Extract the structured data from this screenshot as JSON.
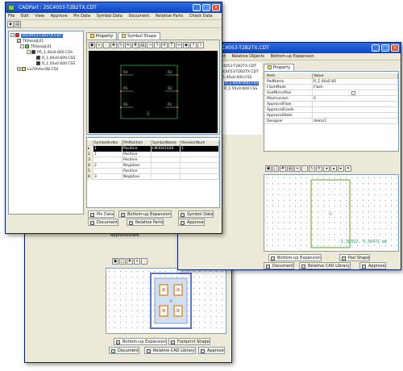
{
  "window1": {
    "title": "CADPart : 2SC4053-T2B2TX.CDT",
    "menu": [
      "File",
      "Edit",
      "View",
      "Approve",
      "Pin Data",
      "Symbol Data",
      "Document",
      "Relative Parts",
      "Check Data"
    ],
    "tree": [
      {
        "label": "2SC4053-T2B2TX.CDT",
        "level": 0,
        "selected": true
      },
      {
        "label": "TRAesaJL01",
        "level": 1
      },
      {
        "label": "TRAesaJL01",
        "level": 2
      },
      {
        "label": "PR_1.40x0.600.CSS",
        "level": 3
      },
      {
        "label": "R_1.40x0.600.CSS",
        "level": 4
      },
      {
        "label": "R_1.50x0.600.CSS",
        "level": 4
      },
      {
        "label": "La70hAsn0B.C56",
        "level": 1
      }
    ],
    "tabs": {
      "property": "Property",
      "symbol_shape": "Symbol Shape"
    },
    "schematic": {
      "pin_labels": [
        "R4",
        "R5",
        "R6",
        "R3",
        "R2",
        "R1"
      ],
      "ref_label": "S"
    },
    "grid": {
      "headers": [
        "SymbolIndex",
        "PinPosition",
        "SymbolName",
        "RevisionNum"
      ],
      "rows": [
        [
          "1",
          "1",
          "Positive",
          "LM3041026",
          "1"
        ],
        [
          "2",
          "1",
          "Positive",
          "",
          ""
        ],
        [
          "3",
          "",
          "Positive",
          "",
          ""
        ],
        [
          "4",
          "2",
          "Negative",
          "",
          ""
        ],
        [
          "5",
          "",
          "Positive",
          "",
          ""
        ],
        [
          "6",
          "3",
          "Negative",
          "",
          ""
        ]
      ]
    },
    "bottom_tabs_row1": [
      "Pin Data",
      "Bottom-up Expansion",
      "Symbol Data"
    ],
    "bottom_tabs_row2": [
      "Document",
      "Relative Parts",
      "Approve"
    ]
  },
  "window2": {
    "title": "CADPart : 2SC4053-T2B2TX.CDT",
    "menu": [
      "Document",
      "Relative Objects",
      "Bottom-up Expansion"
    ],
    "tree": [
      "SC4053-T2B2TX.CDT",
      "2SC4053-T2B2TX.CDT",
      "R_1.40x0.600.CSS",
      "R_1.40x0.600.CSS",
      "R_1.50x0.600.CSS"
    ],
    "tab_property": "Property",
    "prop_headers": [
      "Item",
      "Value"
    ],
    "props": [
      [
        "PadName",
        "R_1.40x0.60"
      ],
      [
        "FlashMode",
        "Flash"
      ],
      [
        "UseMirrorPad",
        ""
      ],
      [
        "MaxInvision",
        "0"
      ],
      [
        "ApprovalFlow",
        ""
      ],
      [
        "ApprovalGrade",
        ""
      ],
      [
        "ApprovalState",
        ""
      ],
      [
        "Designer",
        "demo1"
      ]
    ],
    "coords": "-1.38352, 0.30471 mm",
    "bottom_tabs_row1": [
      "Bottom-up Expansion",
      "Pad Shape"
    ],
    "bottom_tabs_row2": [
      "Document",
      "Relative CAD Library",
      "Approve"
    ]
  },
  "window3": {
    "label": "ApprovalState",
    "bottom_tabs_row1": [
      "Bottom-up Expansion",
      "Footprint Shape"
    ],
    "bottom_tabs_row2": [
      "Document",
      "Relative CAD Library",
      "Approve"
    ]
  },
  "colors": {
    "titlebar": "#0a44c4",
    "chrome": "#ece9d8",
    "selection": "#316ac5",
    "pad_green": "#8fc06a",
    "footprint_orange": "#e08a1e"
  }
}
